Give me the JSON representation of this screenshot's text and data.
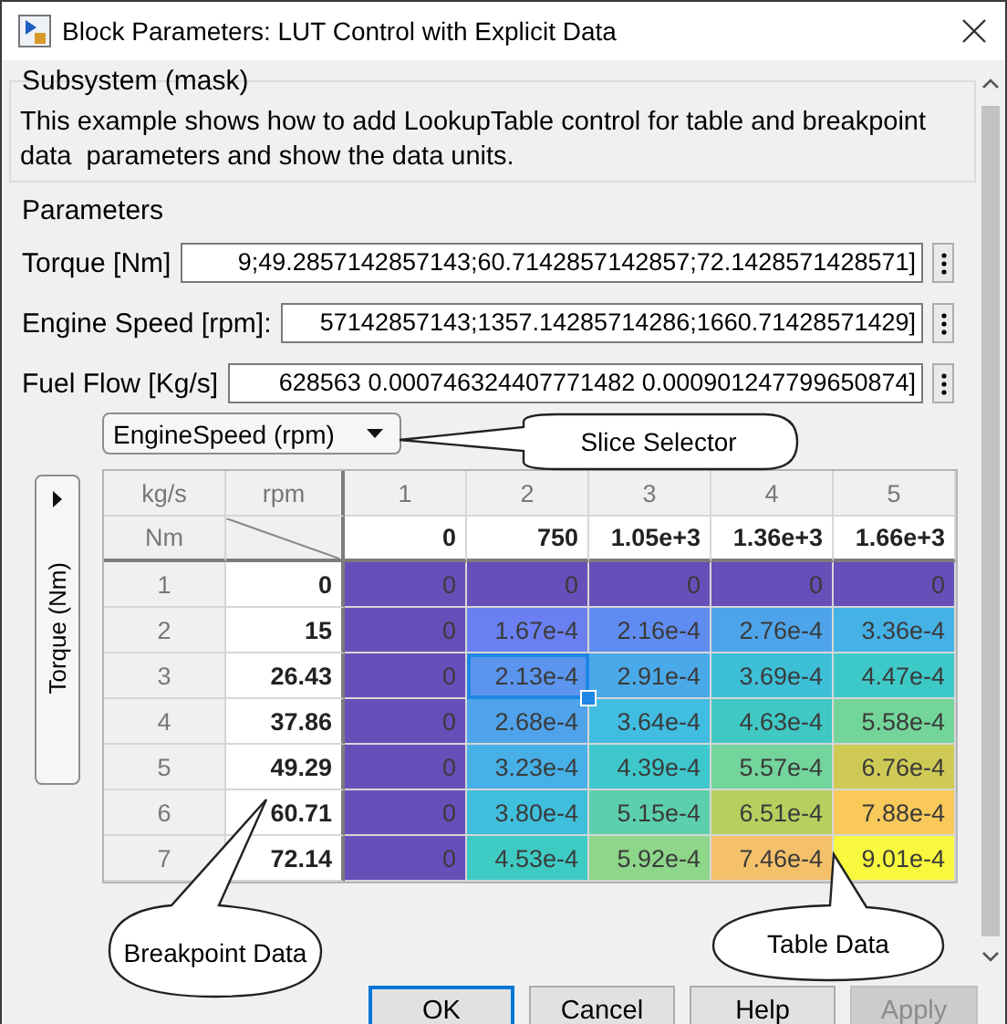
{
  "window": {
    "title": "Block Parameters: LUT Control with Explicit Data"
  },
  "subsystem": {
    "title": "Subsystem (mask)",
    "description": "This example shows how to add LookupTable control for table and breakpoint data  parameters and show the data units."
  },
  "parameters": {
    "title": "Parameters",
    "fields": [
      {
        "label": "Torque [Nm]",
        "value": "9;49.2857142857143;60.7142857142857;72.1428571428571]"
      },
      {
        "label": "Engine Speed [rpm]:",
        "value": "57142857143;1357.14285714286;1660.71428571429]"
      },
      {
        "label": "Fuel Flow [Kg/s]",
        "value": "628563 0.000746324407771482 0.000901247799650874]"
      }
    ]
  },
  "slice_selector": {
    "value": "EngineSpeed (rpm)"
  },
  "axis_button": {
    "label": "Torque (Nm)"
  },
  "table": {
    "output_unit": "kg/s",
    "column_unit": "rpm",
    "row_unit": "Nm",
    "column_indices": [
      "1",
      "2",
      "3",
      "4",
      "5"
    ],
    "column_breakpoints": [
      "0",
      "750",
      "1.05e+3",
      "1.36e+3",
      "1.66e+3"
    ],
    "rows": [
      {
        "index": "1",
        "breakpoint": "0",
        "cells": [
          {
            "value": "0",
            "color": "#674fb9",
            "selected": false
          },
          {
            "value": "0",
            "color": "#674fb9",
            "selected": false
          },
          {
            "value": "0",
            "color": "#674fb9",
            "selected": false
          },
          {
            "value": "0",
            "color": "#674fb9",
            "selected": false
          },
          {
            "value": "0",
            "color": "#674fb9",
            "selected": false
          }
        ]
      },
      {
        "index": "2",
        "breakpoint": "15",
        "cells": [
          {
            "value": "0",
            "color": "#674fb9",
            "selected": false
          },
          {
            "value": "1.67e-4",
            "color": "#6a80f2",
            "selected": false
          },
          {
            "value": "2.16e-4",
            "color": "#5f8cf0",
            "selected": false
          },
          {
            "value": "2.76e-4",
            "color": "#4ea4ea",
            "selected": false
          },
          {
            "value": "3.36e-4",
            "color": "#45b2e6",
            "selected": false
          }
        ]
      },
      {
        "index": "3",
        "breakpoint": "26.43",
        "cells": [
          {
            "value": "0",
            "color": "#674fb9",
            "selected": false
          },
          {
            "value": "2.13e-4",
            "color": "#5b95ee",
            "selected": true
          },
          {
            "value": "2.91e-4",
            "color": "#4aa9e8",
            "selected": false
          },
          {
            "value": "3.69e-4",
            "color": "#3ebfd8",
            "selected": false
          },
          {
            "value": "4.47e-4",
            "color": "#3ec9c9",
            "selected": false
          }
        ]
      },
      {
        "index": "4",
        "breakpoint": "37.86",
        "cells": [
          {
            "value": "0",
            "color": "#674fb9",
            "selected": false
          },
          {
            "value": "2.68e-4",
            "color": "#4fa3ea",
            "selected": false
          },
          {
            "value": "3.64e-4",
            "color": "#40bde0",
            "selected": false
          },
          {
            "value": "4.63e-4",
            "color": "#3fc8c4",
            "selected": false
          },
          {
            "value": "5.58e-4",
            "color": "#74d59a",
            "selected": false
          }
        ]
      },
      {
        "index": "5",
        "breakpoint": "49.29",
        "cells": [
          {
            "value": "0",
            "color": "#674fb9",
            "selected": false
          },
          {
            "value": "3.23e-4",
            "color": "#47b0e6",
            "selected": false
          },
          {
            "value": "4.39e-4",
            "color": "#3ec8cc",
            "selected": false
          },
          {
            "value": "5.57e-4",
            "color": "#73d49c",
            "selected": false
          },
          {
            "value": "6.76e-4",
            "color": "#cfca55",
            "selected": false
          }
        ]
      },
      {
        "index": "6",
        "breakpoint": "60.71",
        "cells": [
          {
            "value": "0",
            "color": "#674fb9",
            "selected": false
          },
          {
            "value": "3.80e-4",
            "color": "#3fbfdc",
            "selected": false
          },
          {
            "value": "5.15e-4",
            "color": "#5cd0ac",
            "selected": false
          },
          {
            "value": "6.51e-4",
            "color": "#b8cf5f",
            "selected": false
          },
          {
            "value": "7.88e-4",
            "color": "#f9c95a",
            "selected": false
          }
        ]
      },
      {
        "index": "7",
        "breakpoint": "72.14",
        "cells": [
          {
            "value": "0",
            "color": "#674fb9",
            "selected": false
          },
          {
            "value": "4.53e-4",
            "color": "#3ecbc4",
            "selected": false
          },
          {
            "value": "5.92e-4",
            "color": "#8ed68a",
            "selected": false
          },
          {
            "value": "7.46e-4",
            "color": "#f4c16a",
            "selected": false
          },
          {
            "value": "9.01e-4",
            "color": "#f8f83e",
            "selected": false
          }
        ]
      }
    ]
  },
  "callouts": [
    {
      "kind": "slice",
      "text": "Slice Selector"
    },
    {
      "kind": "breakpoint",
      "text": "Breakpoint Data"
    },
    {
      "kind": "table",
      "text": "Table Data"
    }
  ],
  "buttons": [
    {
      "label": "OK",
      "focused": true,
      "disabled": false
    },
    {
      "label": "Cancel",
      "focused": false,
      "disabled": false
    },
    {
      "label": "Help",
      "focused": false,
      "disabled": false
    },
    {
      "label": "Apply",
      "focused": false,
      "disabled": true
    }
  ]
}
